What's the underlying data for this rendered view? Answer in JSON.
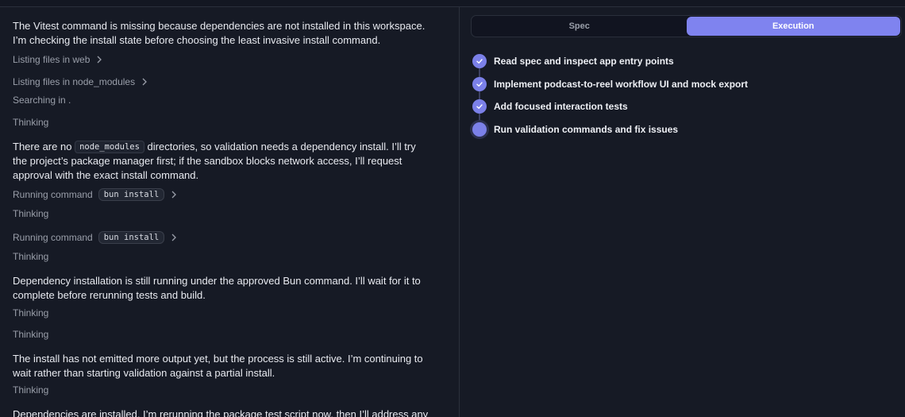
{
  "conversation": {
    "msg1": "The Vitest command is missing because dependencies are not installed in this workspace. I’m checking the install state before choosing the least invasive install command.",
    "step_list_web": "Listing files in web",
    "step_list_node_modules": "Listing files in node_modules",
    "step_searching": "Searching in .",
    "thinking": "Thinking",
    "msg2_before": "There are no",
    "msg2_code": "node_modules",
    "msg2_after": "directories, so validation needs a dependency install. I’ll try the project’s package manager first; if the sandbox blocks network access, I’ll request approval with the exact install command.",
    "running_command": "Running command",
    "command": "bun install",
    "msg3": "Dependency installation is still running under the approved Bun command. I’ll wait for it to complete before rerunning tests and build.",
    "msg4": "The install has not emitted more output yet, but the process is still active. I’m continuing to wait rather than starting validation against a partial install.",
    "msg5": "Dependencies are installed. I’m rerunning the package test script now, then I’ll address any failures before"
  },
  "panel": {
    "tabs": [
      {
        "label": "Spec",
        "active": false
      },
      {
        "label": "Execution",
        "active": true
      }
    ],
    "todos": [
      {
        "label": "Read spec and inspect app entry points",
        "status": "done"
      },
      {
        "label": "Implement podcast-to-reel workflow UI and mock export",
        "status": "done"
      },
      {
        "label": "Add focused interaction tests",
        "status": "done"
      },
      {
        "label": "Run validation commands and fix issues",
        "status": "in-progress"
      }
    ]
  },
  "colors": {
    "background": "#161a25",
    "accent": "#7f83ef",
    "muted_text": "#9a9faa"
  }
}
